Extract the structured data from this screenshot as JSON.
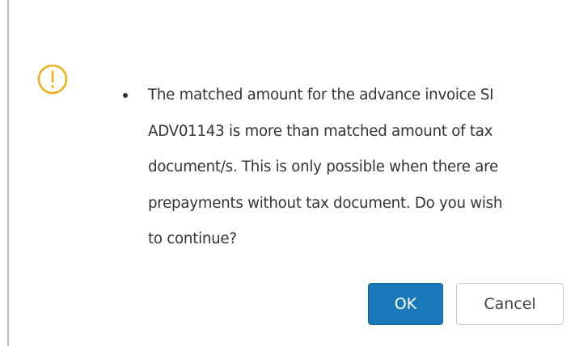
{
  "dialog": {
    "icon": "warning-circle-icon",
    "icon_color": "#f0ad1c",
    "message_lines": [
      "The matched amount for the advance invoice SI",
      "ADV01143 is more than matched amount of tax",
      "document/s. This is only possible when there are",
      "prepayments without tax document. Do you wish",
      "to continue?"
    ]
  },
  "buttons": {
    "ok_label": "OK",
    "cancel_label": "Cancel",
    "primary_color": "#1a7ab9"
  }
}
